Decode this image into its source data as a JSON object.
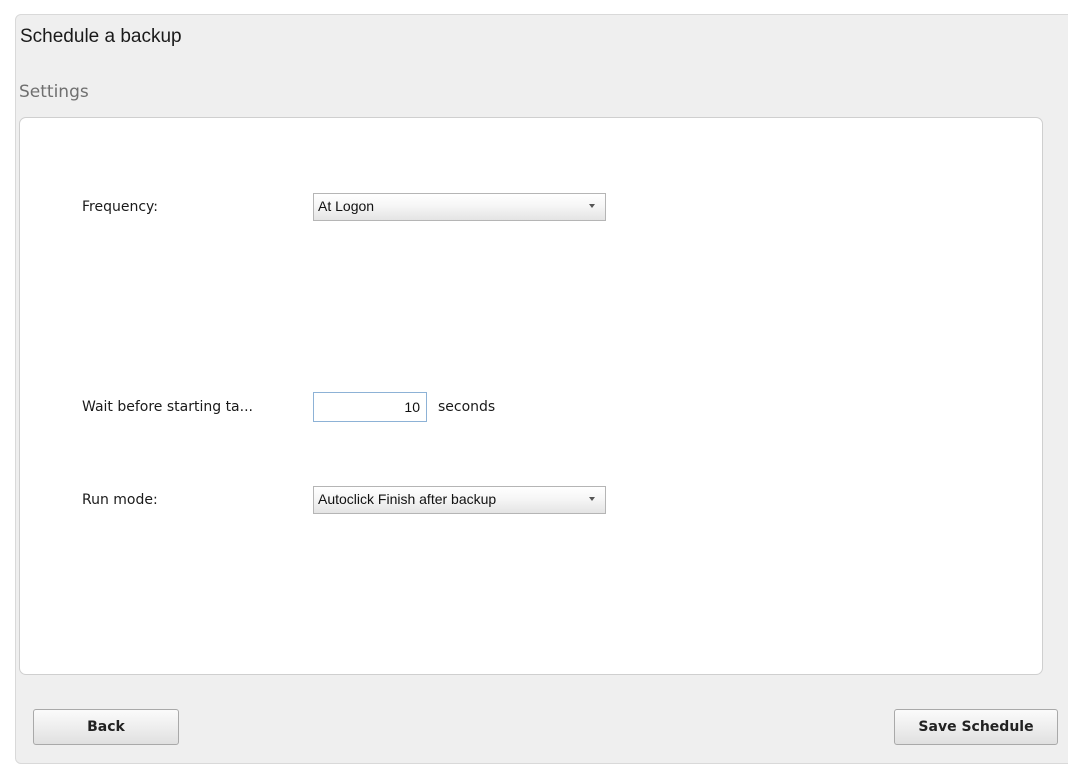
{
  "dialog": {
    "title": "Schedule a backup"
  },
  "settings": {
    "section_title": "Settings",
    "frequency": {
      "label": "Frequency:",
      "value": "At Logon"
    },
    "wait": {
      "label": "Wait before starting ta...",
      "value": "10",
      "unit": "seconds"
    },
    "run_mode": {
      "label": "Run mode:",
      "value": "Autoclick Finish after backup"
    }
  },
  "footer": {
    "back_label": "Back",
    "save_label": "Save Schedule"
  }
}
